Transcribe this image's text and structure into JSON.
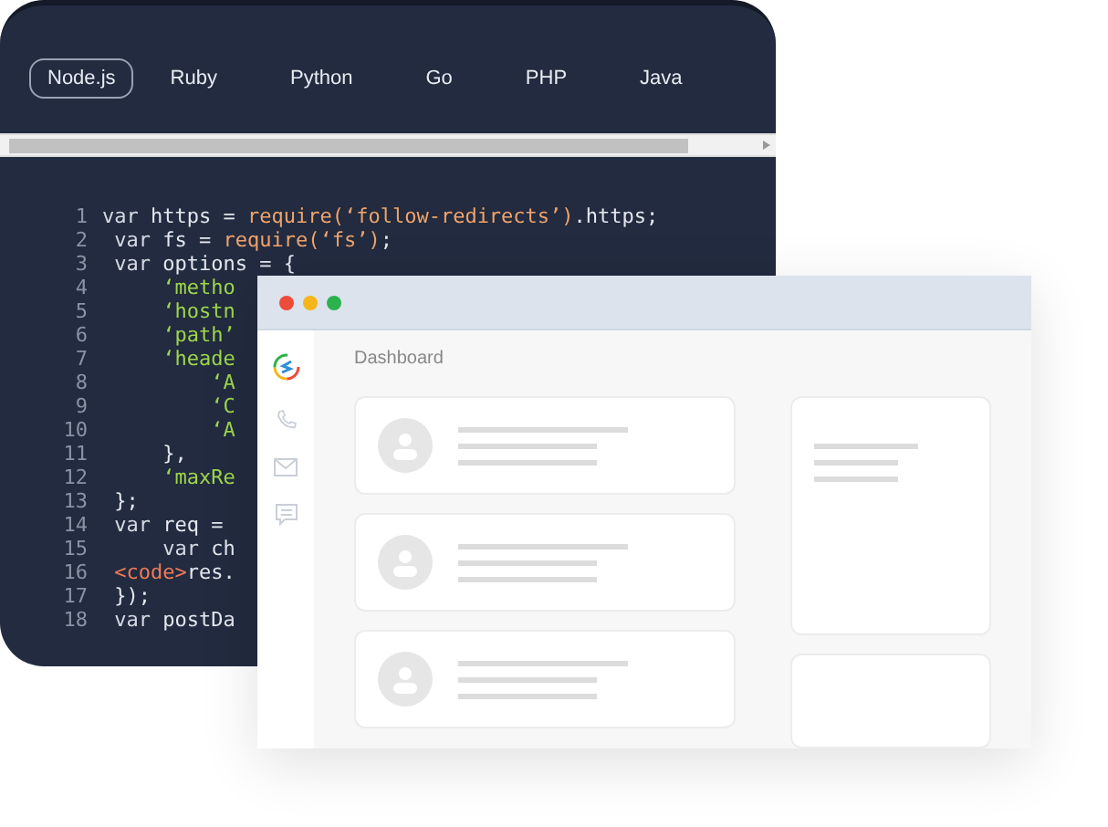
{
  "code_panel": {
    "tabs": [
      {
        "label": "Node.js",
        "selected": true
      },
      {
        "label": "Ruby",
        "selected": false
      },
      {
        "label": "Python",
        "selected": false
      },
      {
        "label": "Go",
        "selected": false
      },
      {
        "label": "PHP",
        "selected": false
      },
      {
        "label": "Java",
        "selected": false
      }
    ],
    "lines": [
      {
        "number": "1",
        "parts": [
          {
            "text": "var",
            "kind": "keyword"
          },
          {
            "text": " https = ",
            "kind": "plain"
          },
          {
            "text": "require(‘follow-redirects’)",
            "kind": "call"
          },
          {
            "text": ".https;",
            "kind": "plain"
          }
        ]
      },
      {
        "number": "2",
        "parts": [
          {
            "text": " var",
            "kind": "keyword"
          },
          {
            "text": " fs = ",
            "kind": "plain"
          },
          {
            "text": "require(‘fs’)",
            "kind": "call"
          },
          {
            "text": ";",
            "kind": "plain"
          }
        ]
      },
      {
        "number": "3",
        "parts": [
          {
            "text": " var",
            "kind": "keyword"
          },
          {
            "text": " options = {",
            "kind": "plain"
          }
        ]
      },
      {
        "number": "4",
        "parts": [
          {
            "text": "     ‘metho",
            "kind": "string"
          }
        ]
      },
      {
        "number": "5",
        "parts": [
          {
            "text": "     ‘hostn",
            "kind": "string"
          }
        ]
      },
      {
        "number": "6",
        "parts": [
          {
            "text": "     ‘path’",
            "kind": "string"
          }
        ]
      },
      {
        "number": "7",
        "parts": [
          {
            "text": "     ‘heade",
            "kind": "string"
          }
        ]
      },
      {
        "number": "8",
        "parts": [
          {
            "text": "         ‘A",
            "kind": "string"
          }
        ]
      },
      {
        "number": "9",
        "parts": [
          {
            "text": "         ‘C",
            "kind": "string"
          }
        ]
      },
      {
        "number": "10",
        "parts": [
          {
            "text": "         ‘A",
            "kind": "string"
          }
        ]
      },
      {
        "number": "11",
        "parts": [
          {
            "text": "     },",
            "kind": "plain"
          }
        ]
      },
      {
        "number": "12",
        "parts": [
          {
            "text": "     ‘maxRe",
            "kind": "string"
          }
        ]
      },
      {
        "number": "13",
        "parts": [
          {
            "text": " };",
            "kind": "plain"
          }
        ]
      },
      {
        "number": "14",
        "parts": [
          {
            "text": " var",
            "kind": "keyword"
          },
          {
            "text": " req =",
            "kind": "plain"
          }
        ]
      },
      {
        "number": "15",
        "parts": [
          {
            "text": "     var",
            "kind": "keyword"
          },
          {
            "text": " ch",
            "kind": "plain"
          }
        ]
      },
      {
        "number": "16",
        "parts": [
          {
            "text": " <code>",
            "kind": "tag"
          },
          {
            "text": "res.",
            "kind": "plain"
          }
        ]
      },
      {
        "number": "17",
        "parts": [
          {
            "text": " });",
            "kind": "plain"
          }
        ]
      },
      {
        "number": "18",
        "parts": [
          {
            "text": " var",
            "kind": "keyword"
          },
          {
            "text": " postDa",
            "kind": "plain"
          }
        ]
      }
    ]
  },
  "dashboard": {
    "title": "Dashboard",
    "cards": [
      {
        "kind": "contact"
      },
      {
        "kind": "contact"
      },
      {
        "kind": "contact"
      }
    ],
    "side_cards": [
      {
        "kind": "lines"
      },
      {
        "kind": "blank"
      }
    ]
  }
}
